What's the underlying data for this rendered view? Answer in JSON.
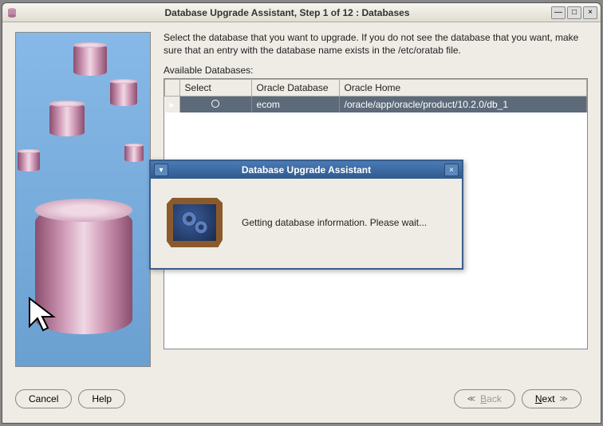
{
  "window": {
    "title": "Database Upgrade Assistant, Step 1 of 12 : Databases"
  },
  "main": {
    "instructions": "Select the database that you want to upgrade. If you do not see the database that you want, make sure that an entry with the database name exists in the /etc/oratab file.",
    "available_label": "Available Databases:",
    "table": {
      "headers": {
        "select": "Select",
        "db": "Oracle Database",
        "home": "Oracle Home"
      },
      "rows": [
        {
          "db": "ecom",
          "home": "/oracle/app/oracle/product/10.2.0/db_1"
        }
      ]
    }
  },
  "buttons": {
    "cancel": "Cancel",
    "help": "Help",
    "back": "Back",
    "next": "Next"
  },
  "modal": {
    "title": "Database Upgrade Assistant",
    "message": "Getting database information. Please wait..."
  }
}
